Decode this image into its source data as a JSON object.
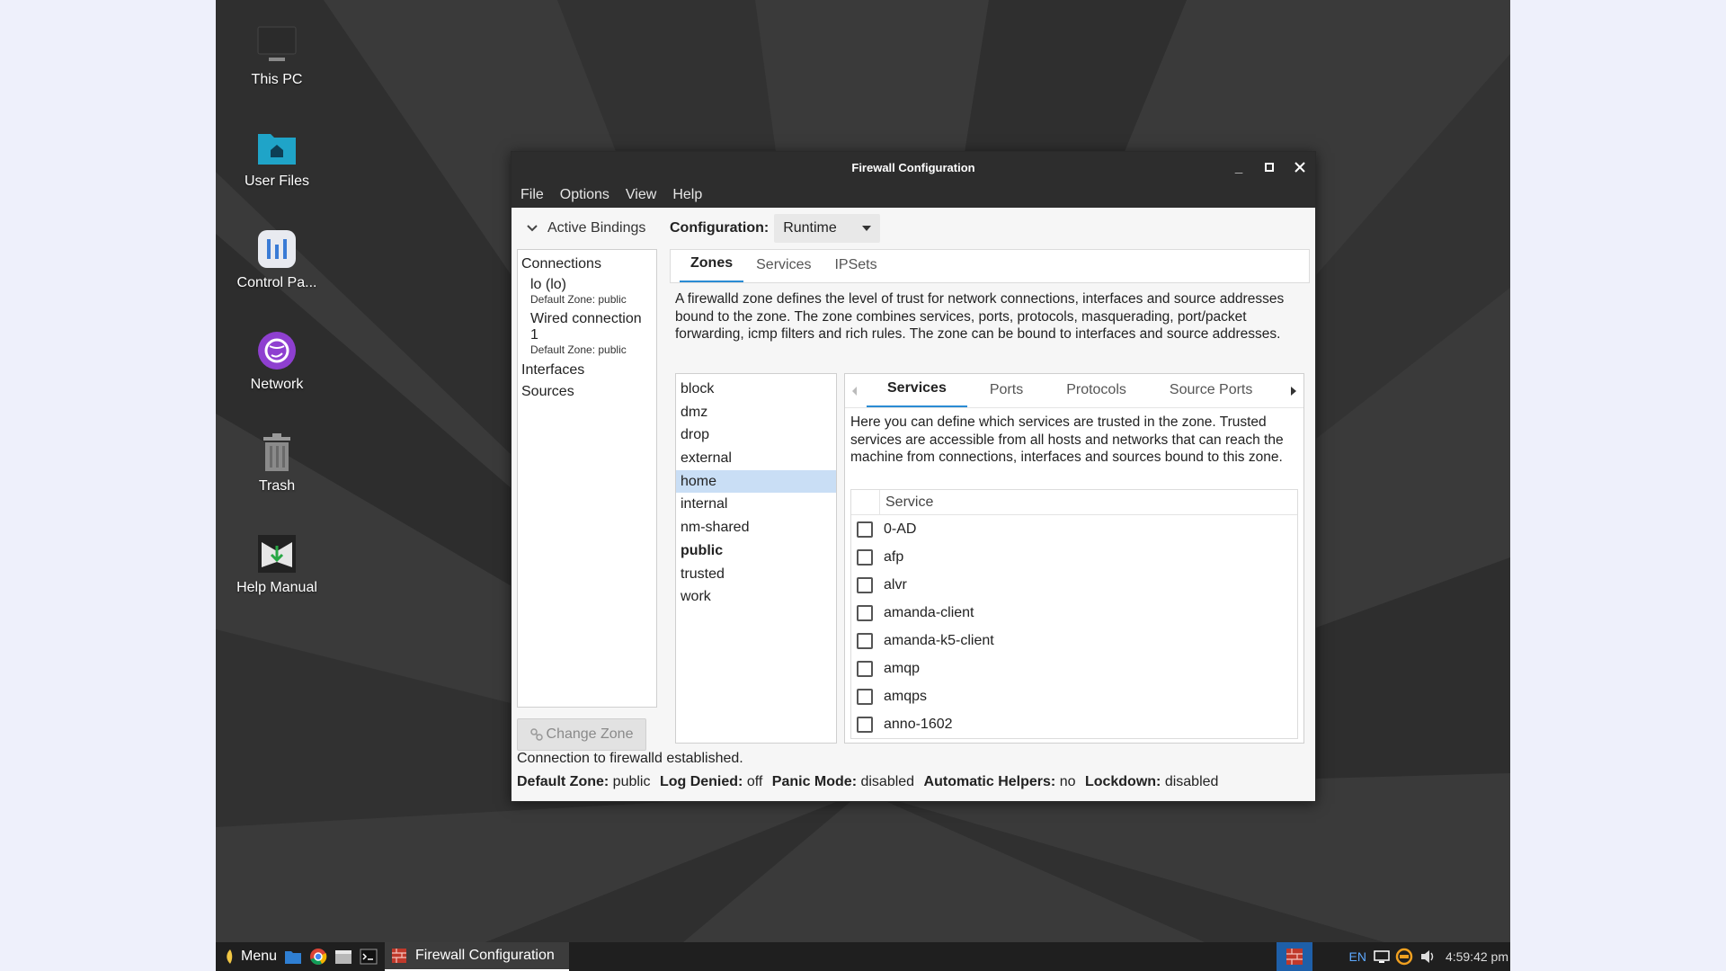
{
  "desktop": {
    "icons": [
      {
        "label": "This PC",
        "icon": "computer-icon"
      },
      {
        "label": "User Files",
        "icon": "home-folder-icon"
      },
      {
        "label": "Control Pa...",
        "icon": "control-panel-icon"
      },
      {
        "label": "Network",
        "icon": "network-globe-icon"
      },
      {
        "label": "Trash",
        "icon": "trash-icon"
      },
      {
        "label": "Help Manual",
        "icon": "help-manual-icon"
      }
    ]
  },
  "window": {
    "title": "Firewall Configuration",
    "menu": [
      "File",
      "Options",
      "View",
      "Help"
    ],
    "left": {
      "header": "Active Bindings",
      "connections_label": "Connections",
      "connections": [
        {
          "name": "lo (lo)",
          "zone": "Default Zone: public"
        },
        {
          "name": "Wired connection 1",
          "zone": "Default Zone: public"
        }
      ],
      "interfaces_label": "Interfaces",
      "sources_label": "Sources",
      "change_zone": "Change Zone"
    },
    "configuration": {
      "label": "Configuration:",
      "value": "Runtime"
    },
    "main_tabs": [
      "Zones",
      "Services",
      "IPSets"
    ],
    "zone_description": "A firewalld zone defines the level of trust for network connections, interfaces and source addresses bound to the zone. The zone combines services, ports, protocols, masquerading, port/packet forwarding, icmp filters and rich rules. The zone can be bound to interfaces and source addresses.",
    "zones": [
      "block",
      "dmz",
      "drop",
      "external",
      "home",
      "internal",
      "nm-shared",
      "public",
      "trusted",
      "work"
    ],
    "selected_zone": "home",
    "default_zone": "public",
    "sub_tabs": [
      "Services",
      "Ports",
      "Protocols",
      "Source Ports"
    ],
    "services_description": "Here you can define which services are trusted in the zone. Trusted services are accessible from all hosts and networks that can reach the machine from connections, interfaces and sources bound to this zone.",
    "service_column": "Service",
    "services": [
      "0-AD",
      "afp",
      "alvr",
      "amanda-client",
      "amanda-k5-client",
      "amqp",
      "amqps",
      "anno-1602"
    ],
    "status": {
      "connection": "Connection to firewalld established.",
      "default_zone_label": "Default Zone:",
      "default_zone_value": "public",
      "log_denied_label": "Log Denied:",
      "log_denied_value": "off",
      "panic_label": "Panic Mode:",
      "panic_value": "disabled",
      "helpers_label": "Automatic Helpers:",
      "helpers_value": "no",
      "lockdown_label": "Lockdown:",
      "lockdown_value": "disabled"
    }
  },
  "taskbar": {
    "menu_label": "Menu",
    "task_label": "Firewall Configuration",
    "lang": "EN",
    "clock": "4:59:42 pm"
  },
  "colors": {
    "accent": "#2a8bd4",
    "selection": "#c9def5",
    "titlebar": "#2d2d2d"
  }
}
